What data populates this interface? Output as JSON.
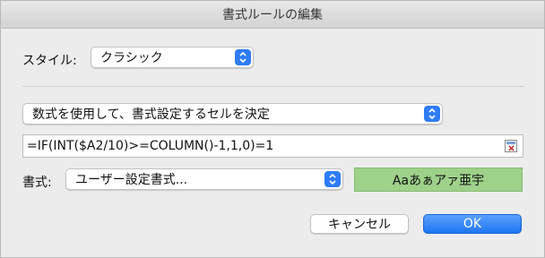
{
  "window": {
    "title": "書式ルールの編集"
  },
  "style_row": {
    "label": "スタイル:",
    "value": "クラシック"
  },
  "rule_type": {
    "value": "数式を使用して、書式設定するセルを決定"
  },
  "formula": {
    "value": "=IF(INT($A2/10)>=COLUMN()-1,1,0)=1"
  },
  "format_row": {
    "label": "書式:",
    "value": "ユーザー設定書式...",
    "preview_text": "Aaあぁアァ亜宇",
    "preview_color": "#9ed18a"
  },
  "buttons": {
    "cancel": "キャンセル",
    "ok": "OK"
  },
  "colors": {
    "accent": "#2f7cf6"
  }
}
